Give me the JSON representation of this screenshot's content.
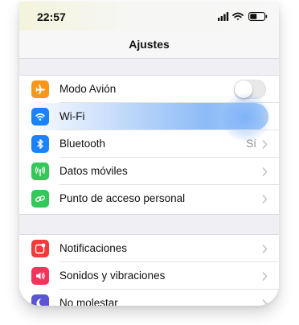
{
  "status_bar": {
    "time": "22:57"
  },
  "nav": {
    "title": "Ajustes"
  },
  "group1": [
    {
      "label": "Modo Avión",
      "icon": "airplane-icon",
      "color": "#f7981c",
      "accessory": "toggle",
      "toggle_on": false
    },
    {
      "label": "Wi-Fi",
      "icon": "wifi-icon",
      "color": "#1a82fb",
      "accessory": "chevron",
      "highlighted": true
    },
    {
      "label": "Bluetooth",
      "icon": "bluetooth-icon",
      "color": "#1a82fb",
      "accessory": "value",
      "value": "Sí"
    },
    {
      "label": "Datos móviles",
      "icon": "antenna-icon",
      "color": "#34c759",
      "accessory": "chevron"
    },
    {
      "label": "Punto de acceso personal",
      "icon": "link-icon",
      "color": "#34c759",
      "accessory": "chevron"
    }
  ],
  "group2": [
    {
      "label": "Notificaciones",
      "icon": "notifications-icon",
      "color": "#f23a3a",
      "accessory": "chevron"
    },
    {
      "label": "Sonidos y vibraciones",
      "icon": "speaker-icon",
      "color": "#f2335a",
      "accessory": "chevron"
    },
    {
      "label": "No molestar",
      "icon": "moon-icon",
      "color": "#5b55d6",
      "accessory": "chevron"
    }
  ]
}
